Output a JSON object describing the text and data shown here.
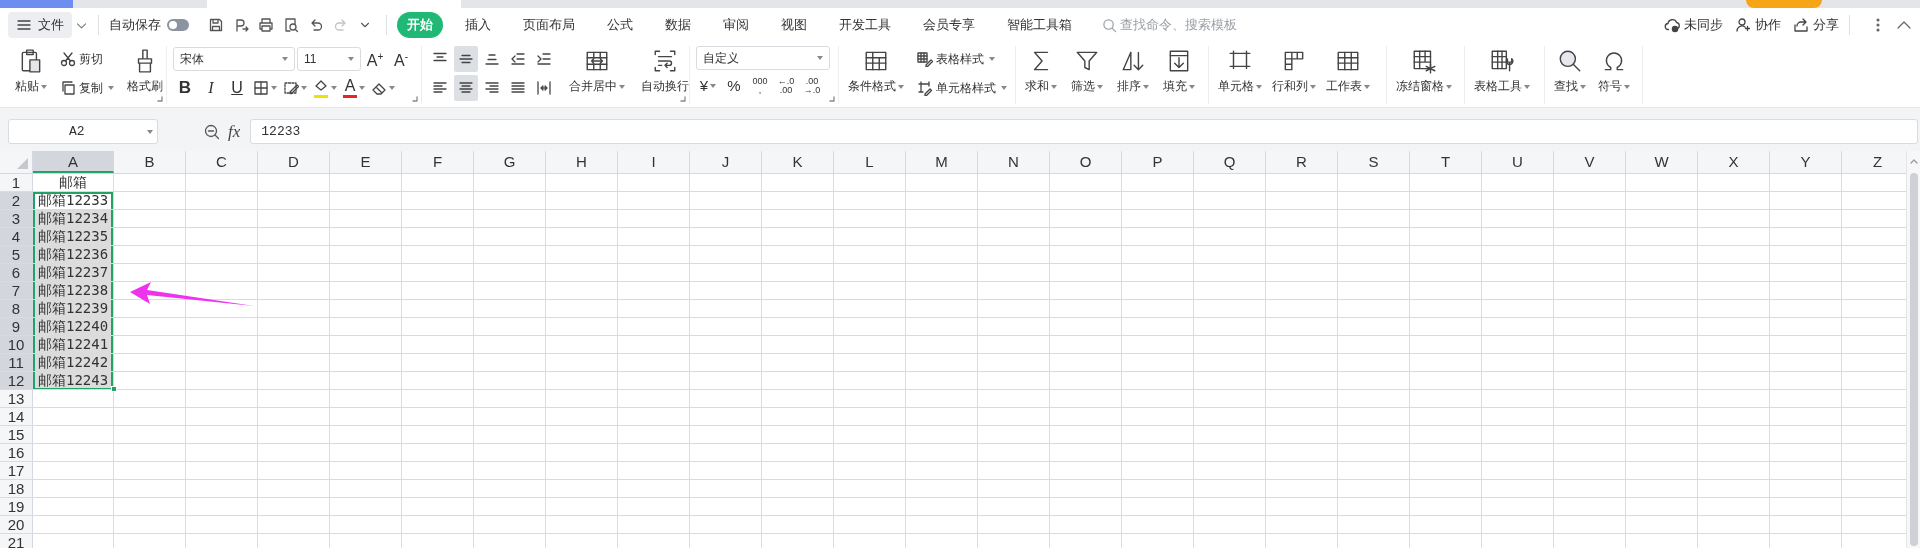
{
  "menu_bar": {
    "file_menu": {
      "label": "文件"
    },
    "autosave": {
      "label": "自动保存",
      "on": false
    },
    "quick_access": [
      {
        "disabled": false
      },
      {
        "disabled": false
      },
      {
        "disabled": false
      },
      {
        "disabled": false
      },
      {
        "disabled": false
      },
      {
        "disabled": true
      }
    ],
    "tabs": [
      {
        "label": "开始",
        "selected": true
      },
      {
        "label": "插入",
        "selected": false
      },
      {
        "label": "页面布局",
        "selected": false
      },
      {
        "label": "公式",
        "selected": false
      },
      {
        "label": "数据",
        "selected": false
      },
      {
        "label": "审阅",
        "selected": false
      },
      {
        "label": "视图",
        "selected": false
      },
      {
        "label": "开发工具",
        "selected": false
      },
      {
        "label": "会员专享",
        "selected": false
      },
      {
        "label": "智能工具箱",
        "selected": false
      }
    ],
    "search": {
      "placeholder": "查找命令、搜索模板"
    },
    "actions": [
      {
        "label": "未同步"
      },
      {
        "label": "协作"
      },
      {
        "label": "分享"
      }
    ]
  },
  "ribbon": {
    "groups": [
      {
        "kind": "clipboard",
        "launcher": true,
        "items": [
          {
            "kind": "large",
            "label": "粘贴",
            "dropdown": true
          },
          {
            "kind": "stack",
            "items": [
              {
                "kind": "small",
                "label": "剪切",
                "dropdown": false
              },
              {
                "kind": "small",
                "label": "复制",
                "dropdown": true
              }
            ]
          },
          {
            "kind": "large",
            "label": "格式刷",
            "dropdown": false
          }
        ]
      },
      {
        "kind": "font",
        "launcher": true,
        "items": [
          {
            "kind": "stack",
            "items": [
              {
                "kind": "row",
                "items": [
                  {
                    "kind": "select",
                    "value": "宋体"
                  },
                  {
                    "kind": "select",
                    "value": "11"
                  },
                  {
                    "kind": "icon",
                    "text": "A$^{+}$",
                    "dropdown": false
                  },
                  {
                    "kind": "icon",
                    "text": "A$^{-}$",
                    "dropdown": false
                  }
                ]
              },
              {
                "kind": "row",
                "items": [
                  {
                    "kind": "icon",
                    "text": "B",
                    "dropdown": false
                  },
                  {
                    "kind": "icon",
                    "text": "I",
                    "dropdown": false
                  },
                  {
                    "kind": "icon",
                    "text": "U",
                    "dropdown": false
                  },
                  {
                    "kind": "icon",
                    "dropdown": true
                  },
                  {
                    "kind": "icon",
                    "dropdown": true
                  },
                  {
                    "kind": "icon",
                    "dropdown": true,
                    "color": "#f2e100"
                  },
                  {
                    "kind": "icon",
                    "text": "A",
                    "dropdown": true,
                    "color": "#e8262a"
                  },
                  {
                    "kind": "icon",
                    "dropdown": true
                  }
                ]
              }
            ]
          }
        ]
      },
      {
        "kind": "alignment",
        "launcher": true,
        "items": [
          {
            "kind": "stack",
            "items": [
              {
                "kind": "row",
                "items": [
                  {
                    "kind": "icon",
                    "selected": false,
                    "dropdown": false
                  },
                  {
                    "kind": "icon",
                    "selected": true,
                    "dropdown": false
                  },
                  {
                    "kind": "icon",
                    "selected": false,
                    "dropdown": false
                  },
                  {
                    "kind": "icon",
                    "selected": false,
                    "dropdown": false
                  },
                  {
                    "kind": "icon",
                    "selected": false,
                    "dropdown": false
                  }
                ]
              },
              {
                "kind": "row",
                "items": [
                  {
                    "kind": "icon",
                    "selected": false,
                    "dropdown": false
                  },
                  {
                    "kind": "icon",
                    "selected": true,
                    "dropdown": false
                  },
                  {
                    "kind": "icon",
                    "selected": false,
                    "dropdown": false
                  },
                  {
                    "kind": "icon",
                    "selected": false,
                    "dropdown": false
                  },
                  {
                    "kind": "icon",
                    "selected": false,
                    "dropdown": false
                  }
                ]
              }
            ]
          },
          {
            "kind": "large",
            "label": "合并居中",
            "dropdown": true
          },
          {
            "kind": "large",
            "label": "自动换行",
            "dropdown": false
          }
        ]
      },
      {
        "kind": "number",
        "launcher": true,
        "items": [
          {
            "kind": "stack",
            "items": [
              {
                "kind": "row",
                "items": [
                  {
                    "kind": "select",
                    "value": "自定义"
                  }
                ]
              },
              {
                "kind": "row",
                "items": [
                  {
                    "kind": "icon",
                    "text": "¥",
                    "dropdown": true
                  },
                  {
                    "kind": "icon",
                    "text": "%",
                    "dropdown": false
                  },
                  {
                    "kind": "icon",
                    "text": "000\n,",
                    "dropdown": false
                  },
                  {
                    "kind": "icon",
                    "text": "←.0\n.00",
                    "dropdown": false
                  },
                  {
                    "kind": "icon",
                    "text": ".00\n→.0",
                    "dropdown": false
                  }
                ]
              }
            ]
          }
        ]
      },
      {
        "kind": "styles",
        "launcher": false,
        "items": [
          {
            "kind": "large",
            "label": "条件格式",
            "dropdown": true
          },
          {
            "kind": "stack",
            "items": [
              {
                "kind": "small",
                "label": "表格样式",
                "dropdown": true
              },
              {
                "kind": "small",
                "label": "单元格样式",
                "dropdown": true
              }
            ]
          }
        ]
      },
      {
        "kind": "editing",
        "launcher": false,
        "items": [
          {
            "kind": "large",
            "label": "求和",
            "dropdown": true
          },
          {
            "kind": "large",
            "label": "筛选",
            "dropdown": true
          },
          {
            "kind": "large",
            "label": "排序",
            "dropdown": true
          },
          {
            "kind": "large",
            "label": "填充",
            "dropdown": true
          }
        ]
      },
      {
        "kind": "cells",
        "launcher": false,
        "items": [
          {
            "kind": "large",
            "label": "单元格",
            "dropdown": true
          },
          {
            "kind": "large",
            "label": "行和列",
            "dropdown": true
          },
          {
            "kind": "large",
            "label": "工作表",
            "dropdown": true
          }
        ]
      },
      {
        "kind": "window",
        "launcher": false,
        "items": [
          {
            "kind": "large",
            "label": "冻结窗格",
            "dropdown": true
          }
        ]
      },
      {
        "kind": "tools",
        "launcher": false,
        "items": [
          {
            "kind": "large",
            "label": "表格工具",
            "dropdown": true
          }
        ]
      },
      {
        "kind": "insert",
        "launcher": false,
        "items": [
          {
            "kind": "large",
            "label": "查找",
            "dropdown": true
          },
          {
            "kind": "large",
            "label": "符号",
            "dropdown": true
          }
        ]
      }
    ]
  },
  "formula_bar": {
    "cell_ref": "A2",
    "fx": "fx",
    "value": "12233"
  },
  "sheet": {
    "columns": [
      {
        "label": "A",
        "selected": true
      },
      {
        "label": "B",
        "selected": false
      },
      {
        "label": "C",
        "selected": false
      },
      {
        "label": "D",
        "selected": false
      },
      {
        "label": "E",
        "selected": false
      },
      {
        "label": "F",
        "selected": false
      },
      {
        "label": "G",
        "selected": false
      },
      {
        "label": "H",
        "selected": false
      },
      {
        "label": "I",
        "selected": false
      },
      {
        "label": "J",
        "selected": false
      },
      {
        "label": "K",
        "selected": false
      },
      {
        "label": "L",
        "selected": false
      },
      {
        "label": "M",
        "selected": false
      },
      {
        "label": "N",
        "selected": false
      },
      {
        "label": "O",
        "selected": false
      },
      {
        "label": "P",
        "selected": false
      },
      {
        "label": "Q",
        "selected": false
      },
      {
        "label": "R",
        "selected": false
      },
      {
        "label": "S",
        "selected": false
      },
      {
        "label": "T",
        "selected": false
      },
      {
        "label": "U",
        "selected": false
      },
      {
        "label": "V",
        "selected": false
      },
      {
        "label": "W",
        "selected": false
      },
      {
        "label": "X",
        "selected": false
      },
      {
        "label": "Y",
        "selected": false
      },
      {
        "label": "Z",
        "selected": false
      }
    ],
    "rows": [
      {
        "number": "1",
        "selected": false,
        "cells": [
          {
            "text": "邮箱",
            "centered": true,
            "active": false
          }
        ]
      },
      {
        "number": "2",
        "selected": true,
        "cells": [
          {
            "text": "邮箱12233",
            "centered": false,
            "active": true
          }
        ]
      },
      {
        "number": "3",
        "selected": true,
        "cells": [
          {
            "text": "邮箱12234",
            "centered": false,
            "active": false
          }
        ]
      },
      {
        "number": "4",
        "selected": true,
        "cells": [
          {
            "text": "邮箱12235",
            "centered": false,
            "active": false
          }
        ]
      },
      {
        "number": "5",
        "selected": true,
        "cells": [
          {
            "text": "邮箱12236",
            "centered": false,
            "active": false
          }
        ]
      },
      {
        "number": "6",
        "selected": true,
        "cells": [
          {
            "text": "邮箱12237",
            "centered": false,
            "active": false
          }
        ]
      },
      {
        "number": "7",
        "selected": true,
        "cells": [
          {
            "text": "邮箱12238",
            "centered": false,
            "active": false
          }
        ]
      },
      {
        "number": "8",
        "selected": true,
        "cells": [
          {
            "text": "邮箱12239",
            "centered": false,
            "active": false
          }
        ]
      },
      {
        "number": "9",
        "selected": true,
        "cells": [
          {
            "text": "邮箱12240",
            "centered": false,
            "active": false
          }
        ]
      },
      {
        "number": "10",
        "selected": true,
        "cells": [
          {
            "text": "邮箱12241",
            "centered": false,
            "active": false
          }
        ]
      },
      {
        "number": "11",
        "selected": true,
        "cells": [
          {
            "text": "邮箱12242",
            "centered": false,
            "active": false
          }
        ]
      },
      {
        "number": "12",
        "selected": true,
        "cells": [
          {
            "text": "邮箱12243",
            "centered": false,
            "active": false
          }
        ]
      },
      {
        "number": "13",
        "selected": false
      },
      {
        "number": "14",
        "selected": false
      },
      {
        "number": "15",
        "selected": false
      },
      {
        "number": "16",
        "selected": false
      },
      {
        "number": "17",
        "selected": false
      },
      {
        "number": "18",
        "selected": false
      },
      {
        "number": "19",
        "selected": false
      },
      {
        "number": "20",
        "selected": false
      },
      {
        "number": "21",
        "selected": false
      }
    ]
  }
}
